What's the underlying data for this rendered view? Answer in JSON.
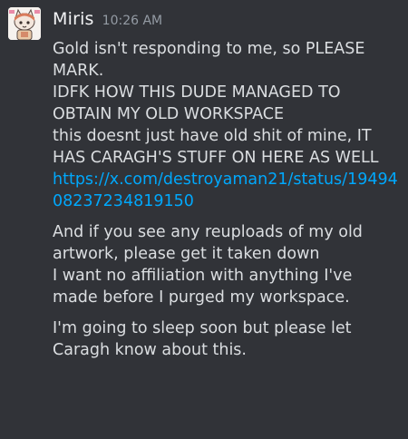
{
  "message": {
    "username": "Miris",
    "timestamp": "10:26 AM",
    "lines": {
      "l1": "Gold isn't responding to me, so PLEASE MARK.",
      "l2": "IDFK HOW THIS DUDE MANAGED TO OBTAIN MY OLD WORKSPACE",
      "l3": "this doesnt just have old shit of mine, IT HAS CARAGH'S STUFF ON HERE AS WELL",
      "link": "https://x.com/destroyaman21/status/1949408237234819150",
      "l4": "And if you see any reuploads of my old artwork, please get it taken down",
      "l5": "I want no affiliation with anything I've made before I purged my workspace.",
      "l6": "I'm going to sleep soon but please let Caragh know about this."
    }
  },
  "colors": {
    "background": "#313338",
    "text": "#dbdee1",
    "username": "#f2f3f5",
    "timestamp": "#949ba4",
    "link": "#00a8fc"
  },
  "icons": {
    "avatar": "avatar-cat-character-icon"
  }
}
